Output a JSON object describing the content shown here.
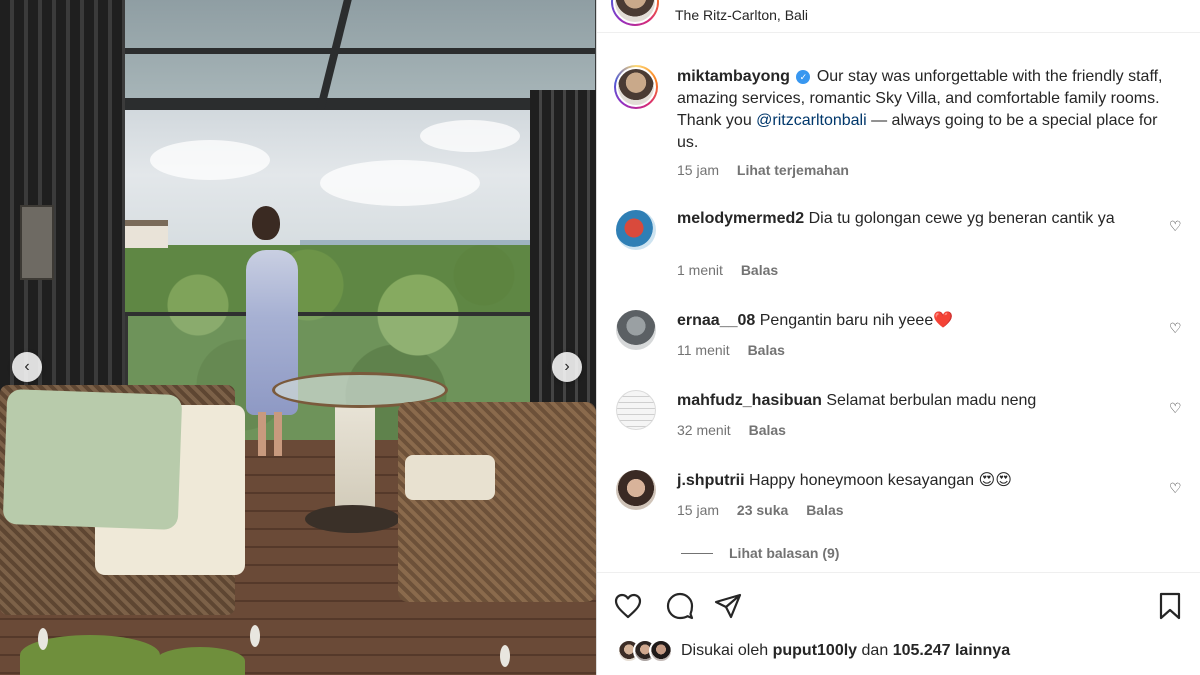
{
  "post": {
    "location": "The Ritz-Carlton, Bali",
    "caption": {
      "username": "miktambayong",
      "verified": true,
      "text_before": "Our stay was unforgettable with the friendly staff, amazing services, romantic Sky Villa, and comfortable family rooms. Thank you ",
      "mention": "@ritzcarltonbali",
      "text_after": " — always going to be a special place for us.",
      "time": "15 jam",
      "translate": "Lihat terjemahan"
    }
  },
  "comments": [
    {
      "username": "melodymermed2",
      "text": "Dia tu golongan cewe yg beneran cantik ya",
      "time": "1 menit",
      "reply": "Balas",
      "likes": ""
    },
    {
      "username": "ernaa__08",
      "text": "Pengantin baru nih yeee❤️",
      "time": "11 menit",
      "reply": "Balas",
      "likes": ""
    },
    {
      "username": "mahfudz_hasibuan",
      "text": "Selamat berbulan madu neng",
      "time": "32 menit",
      "reply": "Balas",
      "likes": ""
    },
    {
      "username": "j.shputrii",
      "text": "Happy honeymoon kesayangan 😍😍",
      "time": "15 jam",
      "reply": "Balas",
      "likes": "23 suka"
    }
  ],
  "view_replies": "Lihat balasan (9)",
  "likes": {
    "prefix": "Disukai oleh",
    "user": "puput100ly",
    "connector": "dan",
    "count": "105.247 lainnya"
  },
  "icons": {
    "like": "heart-icon",
    "comment": "comment-icon",
    "share": "send-icon",
    "save": "bookmark-icon",
    "more": "more-icon",
    "prev": "chevron-left-icon",
    "next": "chevron-right-icon"
  },
  "colors": {
    "verified": "#3897f0",
    "mention": "#00376b",
    "meta": "#737373"
  }
}
